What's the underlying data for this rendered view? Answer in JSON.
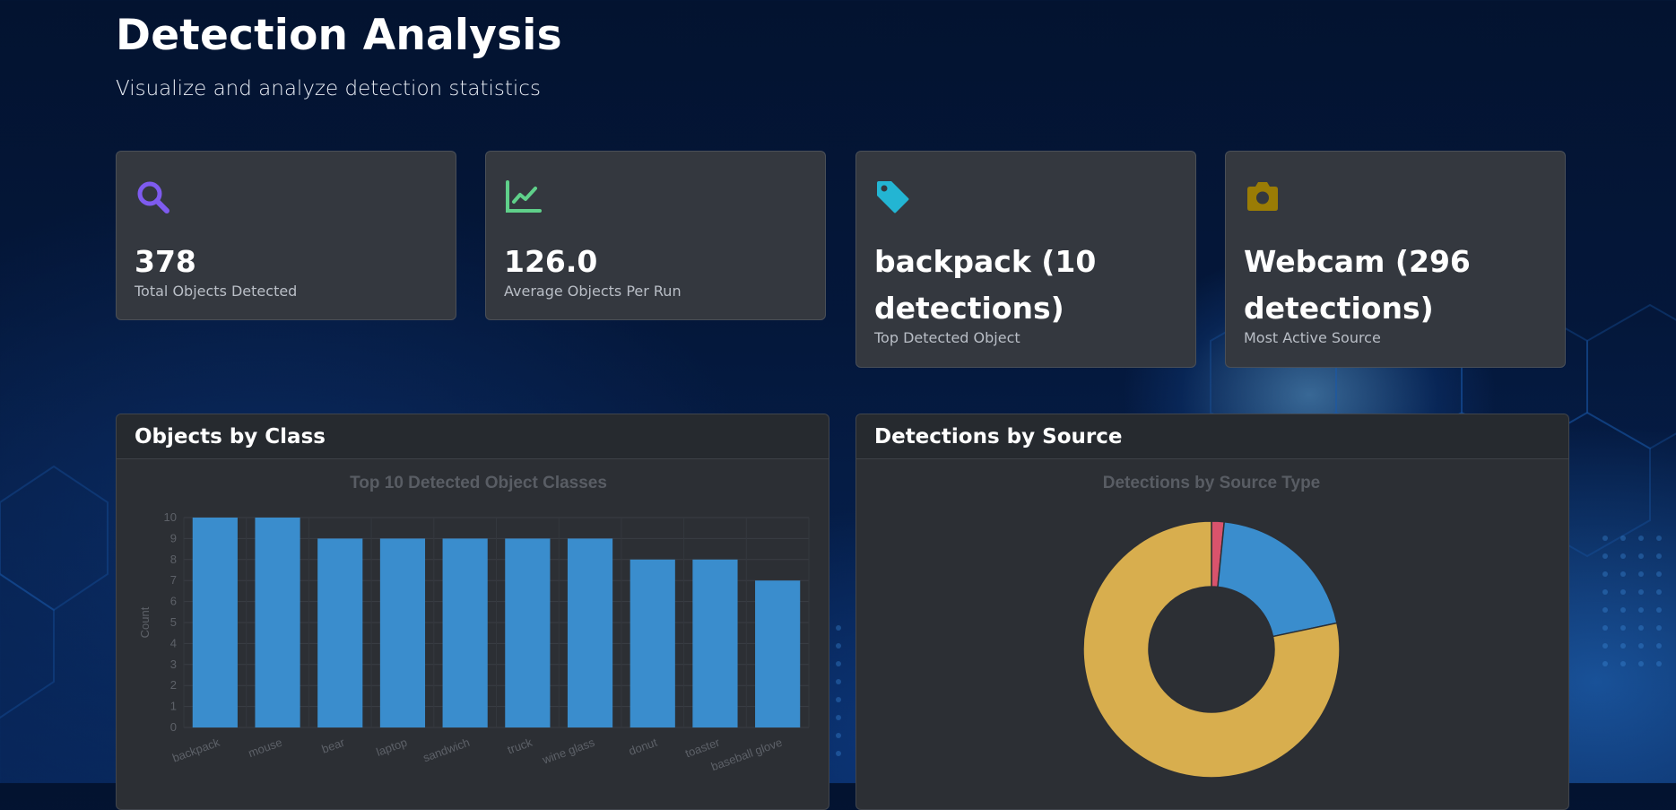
{
  "header": {
    "title": "Detection Analysis",
    "subtitle": "Visualize and analyze detection statistics"
  },
  "stats": [
    {
      "icon": "search-icon",
      "color": "#7e5bef",
      "value": "378",
      "label": "Total Objects Detected"
    },
    {
      "icon": "chart-line-icon",
      "color": "#5fd08a",
      "value": "126.0",
      "label": "Average Objects Per Run"
    },
    {
      "icon": "tag-icon",
      "color": "#23b5d3",
      "value": "backpack (10 detections)",
      "label": "Top Detected Object"
    },
    {
      "icon": "camera-icon",
      "color": "#9a7c05",
      "value": "Webcam (296 detections)",
      "label": "Most Active Source"
    }
  ],
  "panels": {
    "classes": {
      "title": "Objects by Class"
    },
    "sources": {
      "title": "Detections by Source"
    }
  },
  "chart_data": [
    {
      "type": "bar",
      "title": "Top 10 Detected Object Classes",
      "ylabel": "Count",
      "xlabel": "",
      "categories": [
        "backpack",
        "mouse",
        "bear",
        "laptop",
        "sandwich",
        "truck",
        "wine glass",
        "donut",
        "toaster",
        "baseball glove"
      ],
      "values": [
        10,
        10,
        9,
        9,
        9,
        9,
        9,
        8,
        8,
        7
      ],
      "ylim": [
        0,
        10
      ],
      "grid": true,
      "color": "#3a8dcd"
    },
    {
      "type": "pie",
      "style": "doughnut",
      "title": "Detections by Source Type",
      "slices": [
        {
          "value": 6,
          "color": "#d9536c"
        },
        {
          "value": 76,
          "color": "#3a8dcd"
        },
        {
          "value": 296,
          "color": "#d8ae4e"
        }
      ]
    }
  ]
}
